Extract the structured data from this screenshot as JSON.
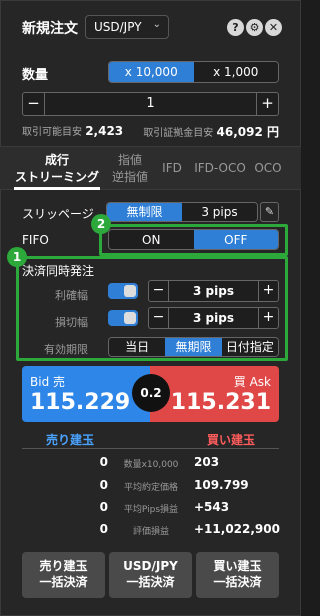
{
  "header": {
    "title": "新規注文",
    "pair": "USD/JPY",
    "help_icon": "?",
    "settings_icon": "⚙",
    "close_icon": "✕"
  },
  "quantity": {
    "label": "数量",
    "unit_options": [
      "x 10,000",
      "x 1,000"
    ],
    "selected_unit": "x 10,000",
    "value": "1",
    "minus": "−",
    "plus": "+",
    "tradable_label": "取引可能目安",
    "tradable_value": "2,423",
    "margin_label": "取引証拠金目安",
    "margin_value": "46,092 円"
  },
  "order_tabs": [
    {
      "line1": "成行",
      "line2": "ストリーミング",
      "active": true
    },
    {
      "line1": "指値",
      "line2": "逆指値",
      "active": false
    },
    {
      "line1": "IFD",
      "line2": "",
      "active": false
    },
    {
      "line1": "IFD-OCO",
      "line2": "",
      "active": false
    },
    {
      "line1": "OCO",
      "line2": "",
      "active": false
    }
  ],
  "slippage": {
    "label": "スリッページ",
    "options": [
      "無制限",
      "3 pips"
    ],
    "selected": "無制限",
    "edit_icon": "✎"
  },
  "fifo": {
    "label": "FIFO",
    "options": [
      "ON",
      "OFF"
    ],
    "selected": "OFF",
    "badge": "2"
  },
  "settlement": {
    "badge": "1",
    "label": "決済同時発注",
    "take_profit": {
      "label": "利確幅",
      "value": "3 pips",
      "enabled": true
    },
    "stop_loss": {
      "label": "損切幅",
      "value": "3 pips",
      "enabled": true
    },
    "expiry": {
      "label": "有効期限",
      "options": [
        "当日",
        "無期限",
        "日付指定"
      ],
      "selected": "無期限"
    }
  },
  "prices": {
    "bid_label": "Bid 売",
    "bid": "115.229",
    "ask_label": "買 Ask",
    "ask": "115.231",
    "spread": "0.2"
  },
  "positions": {
    "sell_header": "売り建玉",
    "buy_header": "買い建玉",
    "rows": [
      {
        "sell": "0",
        "label": "数量x10,000",
        "buy": "203"
      },
      {
        "sell": "0",
        "label": "平均約定価格",
        "buy": "109.799"
      },
      {
        "sell": "0",
        "label": "平均Pips損益",
        "buy": "+543"
      },
      {
        "sell": "0",
        "label": "評価損益",
        "buy": "+11,022,900"
      }
    ]
  },
  "bottom_buttons": [
    {
      "line1": "売り建玉",
      "line2": "一括決済"
    },
    {
      "line1": "USD/JPY",
      "line2": "一括決済"
    },
    {
      "line1": "買い建玉",
      "line2": "一括決済"
    }
  ],
  "colors": {
    "accent_blue": "#2f7fd6",
    "bid_blue": "#2e86e8",
    "ask_red": "#e04848",
    "highlight_green": "#2da83a",
    "sell_header": "#4aa3ff",
    "buy_header": "#ff5c5c"
  }
}
